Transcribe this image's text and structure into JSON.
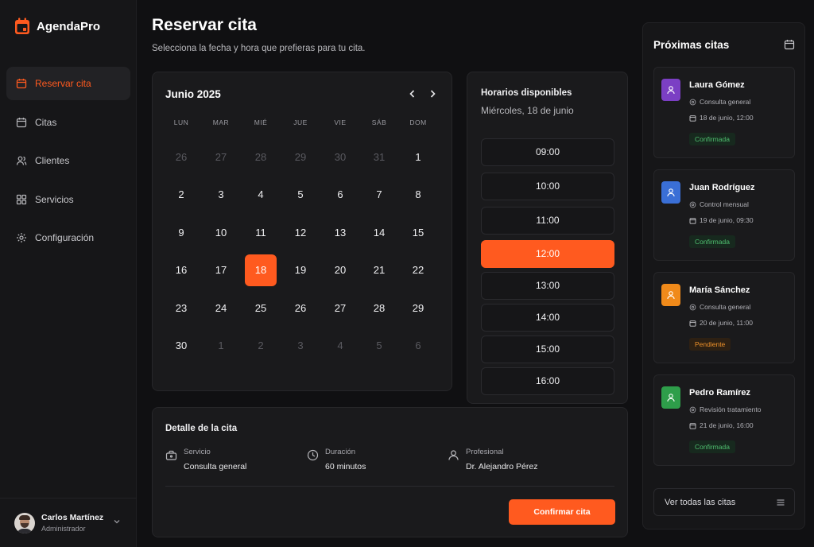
{
  "app": {
    "name": "AgendaPro"
  },
  "sidebar": {
    "items": [
      {
        "label": "Reservar cita",
        "icon": "calendar-icon",
        "active": true
      },
      {
        "label": "Citas",
        "icon": "calendar-outline-icon",
        "active": false
      },
      {
        "label": "Clientes",
        "icon": "users-icon",
        "active": false
      },
      {
        "label": "Servicios",
        "icon": "grid-icon",
        "active": false
      },
      {
        "label": "Configuración",
        "icon": "gear-icon",
        "active": false
      }
    ],
    "user": {
      "name": "Carlos Martínez",
      "role": "Administrador"
    }
  },
  "header": {
    "title": "Reservar cita",
    "subtitle": "Selecciona la fecha y hora que prefieras para tu cita."
  },
  "calendar": {
    "month_label": "Junio 2025",
    "weekdays": [
      "LUN",
      "MAR",
      "MIÉ",
      "JUE",
      "VIE",
      "SÁB",
      "DOM"
    ],
    "weeks": [
      [
        "26",
        "27",
        "28",
        "29",
        "30",
        "31",
        "1"
      ],
      [
        "2",
        "3",
        "4",
        "5",
        "6",
        "7",
        "8"
      ],
      [
        "9",
        "10",
        "11",
        "12",
        "13",
        "14",
        "15"
      ],
      [
        "16",
        "17",
        "18",
        "19",
        "20",
        "21",
        "22"
      ],
      [
        "23",
        "24",
        "25",
        "26",
        "27",
        "28",
        "29"
      ],
      [
        "30",
        "1",
        "2",
        "3",
        "4",
        "5",
        "6"
      ]
    ],
    "selected_day": "18"
  },
  "times": {
    "title": "Horarios disponibles",
    "date_label": "Miércoles, 18 de junio",
    "slots": [
      "09:00",
      "10:00",
      "11:00",
      "12:00",
      "13:00",
      "14:00",
      "15:00",
      "16:00"
    ],
    "selected": "12:00"
  },
  "detail": {
    "title": "Detalle de la cita",
    "service_label": "Servicio",
    "service_value": "Consulta general",
    "duration_label": "Duración",
    "duration_value": "60 minutos",
    "professional_label": "Profesional",
    "professional_value": "Dr. Alejandro Pérez",
    "confirm_label": "Confirmar cita"
  },
  "upcoming": {
    "title": "Próximas citas",
    "items": [
      {
        "name": "Laura Gómez",
        "service": "Consulta general",
        "datetime": "18 de junio, 12:00",
        "status": "Confirmada",
        "color": "#7b3fc4"
      },
      {
        "name": "Juan Rodríguez",
        "service": "Control mensual",
        "datetime": "19 de junio, 09:30",
        "status": "Confirmada",
        "color": "#3a6fd6"
      },
      {
        "name": "María Sánchez",
        "service": "Consulta general",
        "datetime": "20 de junio, 11:00",
        "status": "Pendiente",
        "color": "#f08a1a"
      },
      {
        "name": "Pedro Ramírez",
        "service": "Revisión tratamiento",
        "datetime": "21 de junio, 16:00",
        "status": "Confirmada",
        "color": "#2e9e4a"
      }
    ],
    "view_all_label": "Ver todas las citas"
  },
  "colors": {
    "accent": "#ff5a1f",
    "confirmed": "#4fbf6f",
    "pending": "#f0922a"
  }
}
